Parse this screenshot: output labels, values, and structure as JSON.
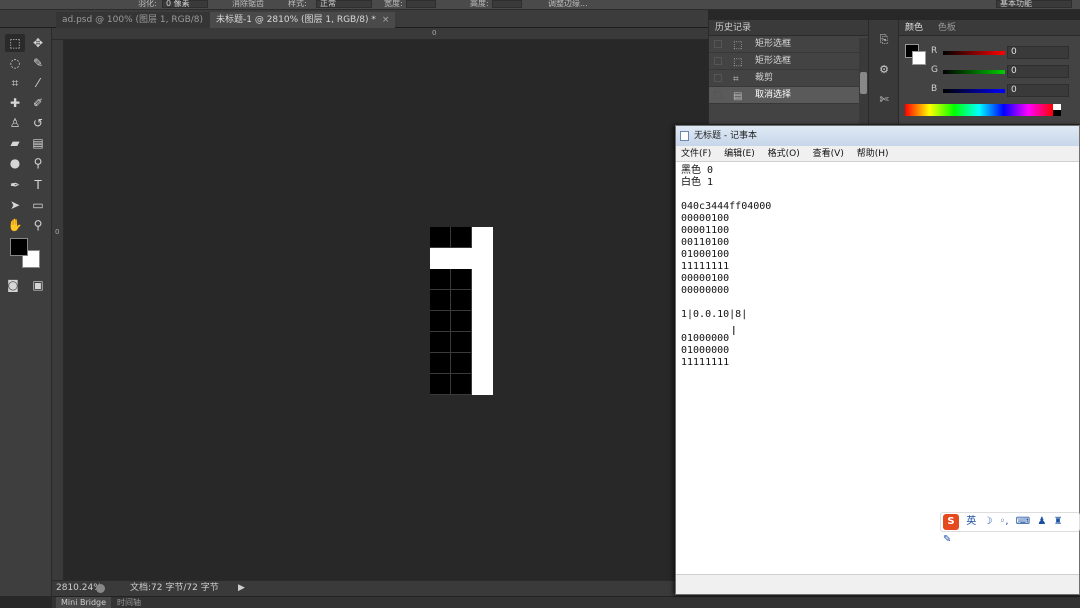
{
  "options_bar": {
    "feather_label": "羽化:",
    "feather_value": "0 像素",
    "antialias_label": "消除锯齿",
    "style_label": "样式:",
    "style_value": "正常",
    "width_label": "宽度:",
    "height_label": "高度:",
    "refine_edge": "调整边缘...",
    "workspace": "基本功能"
  },
  "doc_tabs": [
    {
      "label": "ad.psd @ 100% (图层 1, RGB/8)",
      "close": "×"
    },
    {
      "label": "未标题-1 @ 2810% (图层 1, RGB/8) *",
      "close": "×"
    }
  ],
  "ruler": {
    "top_zero": "0",
    "left_zero": "0"
  },
  "pixel_art": {
    "rows": [
      [
        "b",
        "b",
        "w"
      ],
      [
        "w",
        "w",
        "w"
      ],
      [
        "b",
        "b",
        "w"
      ],
      [
        "b",
        "b",
        "w"
      ],
      [
        "b",
        "b",
        "w"
      ],
      [
        "b",
        "b",
        "w"
      ],
      [
        "b",
        "b",
        "w"
      ],
      [
        "b",
        "b",
        "w"
      ]
    ]
  },
  "status": {
    "zoom": "2810.24%",
    "doc_info": "文档:72 字节/72 字节"
  },
  "bottom_tabs": [
    "Mini Bridge",
    "时间轴"
  ],
  "history": {
    "title": "历史记录",
    "items": [
      {
        "label": "矩形选框",
        "icon": "marquee-icon"
      },
      {
        "label": "矩形选框",
        "icon": "marquee-icon"
      },
      {
        "label": "裁剪",
        "icon": "crop-icon"
      },
      {
        "label": "取消选择",
        "icon": "deselect-icon",
        "active": true
      }
    ]
  },
  "color_panel": {
    "tabs": [
      "颜色",
      "色板"
    ],
    "channels": [
      {
        "name": "R",
        "value": "0",
        "color": "#ff0000"
      },
      {
        "name": "G",
        "value": "0",
        "color": "#00c000"
      },
      {
        "name": "B",
        "value": "0",
        "color": "#0000ff"
      }
    ]
  },
  "notepad": {
    "title": "无标题 - 记事本",
    "menu": [
      "文件(F)",
      "编辑(E)",
      "格式(O)",
      "查看(V)",
      "帮助(H)"
    ],
    "lines": [
      "黑色 0",
      "白色 1",
      "",
      "040c3444ff04000",
      "00000100",
      "00001100",
      "00110100",
      "01000100",
      "11111111",
      "00000100",
      "00000000",
      "",
      "1|0.0.10|8|",
      "",
      "01000000",
      "01000000",
      "11111111"
    ]
  },
  "ime": {
    "logo": "S",
    "mode": "英"
  }
}
